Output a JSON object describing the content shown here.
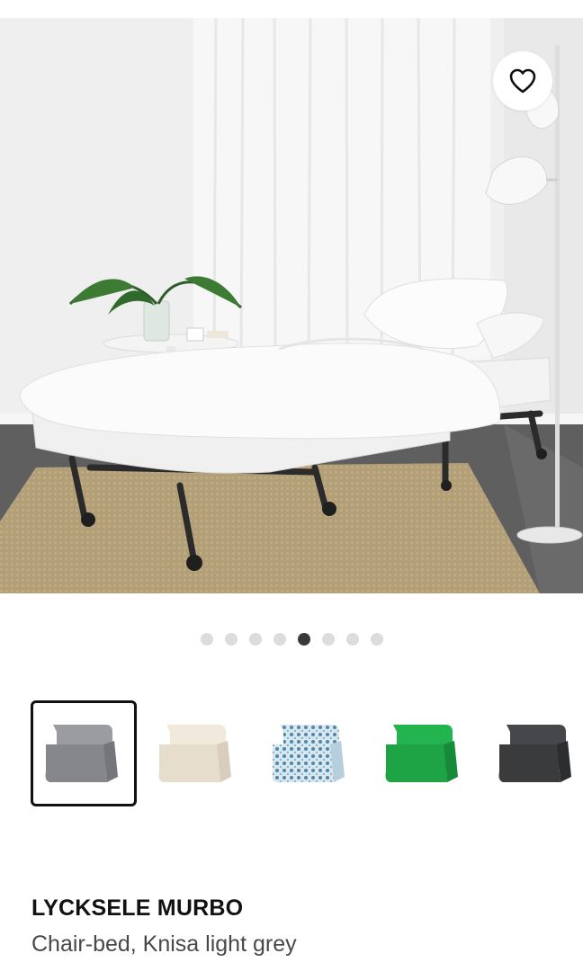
{
  "hero": {
    "image": "LYCKSELE MURBO chair-bed unfolded with white bedding",
    "favourite_icon": "heart-outline-icon"
  },
  "carousel": {
    "total": 8,
    "active_index": 4
  },
  "swatches": [
    {
      "name": "Knisa light grey",
      "color": "#8e9096",
      "selected": true
    },
    {
      "name": "natural",
      "color": "#ece4d6",
      "selected": false
    },
    {
      "name": "patterned blue",
      "color": "#cfe0ea",
      "selected": false
    },
    {
      "name": "bright green",
      "color": "#21b04b",
      "selected": false
    },
    {
      "name": "dark grey",
      "color": "#3c3d3f",
      "selected": false
    }
  ],
  "product": {
    "name": "LYCKSELE MURBO",
    "description": "Chair-bed, Knisa light grey"
  }
}
